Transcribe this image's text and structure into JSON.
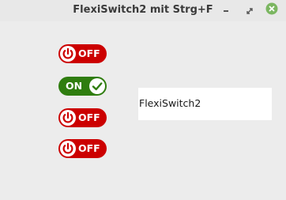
{
  "window": {
    "title": "FlexiSwitch2 mit Strg+F"
  },
  "toggles": [
    {
      "label": "OFF",
      "state": "off"
    },
    {
      "label": "ON",
      "state": "on"
    },
    {
      "label": "OFF",
      "state": "off"
    },
    {
      "label": "OFF",
      "state": "off"
    }
  ],
  "text_field": {
    "value": "FlexiSwitch2"
  },
  "colors": {
    "off": "#cc0000",
    "on": "#2f7d0f",
    "close_button": "#7bb661"
  },
  "icons": {
    "minimize": "minimize-icon",
    "maximize": "maximize-icon",
    "close": "close-icon",
    "power": "power-icon",
    "check": "check-icon"
  }
}
